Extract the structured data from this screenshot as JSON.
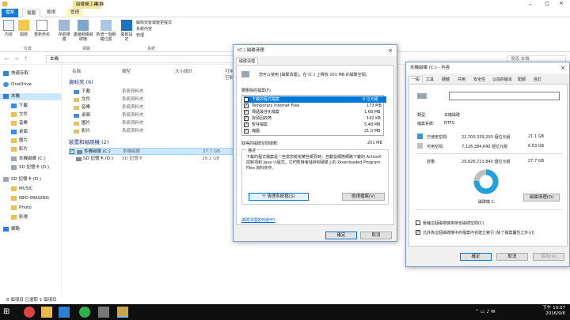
{
  "explorer": {
    "title": "本機",
    "context_tab": "磁碟機工具",
    "tabs": [
      "檔案",
      "電腦",
      "檢視",
      "管理"
    ],
    "ribbon": {
      "buttons": [
        "內容",
        "開啟",
        "重新命名",
        "存取媒體",
        "連線網路磁碟機",
        "新增一個網路位置",
        "開啟設定",
        "解除安裝或變更程式",
        "系統內容",
        "管理"
      ],
      "groups": [
        "位置",
        "網路",
        "系統"
      ]
    },
    "address": "本機",
    "search_placeholder": "搜尋 本機",
    "nav": [
      "快速存取",
      "OneDrive",
      "本機",
      "下載",
      "文件",
      "音樂",
      "桌面",
      "圖片",
      "影片",
      "本機磁碟 (C:)",
      "SD 記憶卡 (D:)",
      "SD 記憶卡 (D:)",
      "MUSIC",
      "NEO IMAGING",
      "Photo",
      "影視",
      "網路"
    ],
    "columns": [
      "名稱",
      "類型",
      "大小總計",
      "可用空間"
    ],
    "folders_header": "資料夾 (6)",
    "folders": [
      {
        "name": "下載",
        "type": "系統資料夾"
      },
      {
        "name": "文件",
        "type": "系統資料夾"
      },
      {
        "name": "音樂",
        "type": "系統資料夾"
      },
      {
        "name": "桌面",
        "type": "系統資料夾"
      },
      {
        "name": "圖片",
        "type": "系統資料夾"
      },
      {
        "name": "影片",
        "type": "系統資料夾"
      }
    ],
    "drives_header": "裝置和磁碟機 (2)",
    "drives": [
      {
        "name": "本機磁碟 (C:)",
        "type": "本機磁碟",
        "total": "27.7 GB",
        "free": "6.63 GB"
      },
      {
        "name": "SD 記憶卡 (D:)",
        "type": "SD 記憶卡",
        "total": "29.2 GB",
        "free": "29.1 GB"
      }
    ],
    "status": "8 個項目   已選取 1 個項目"
  },
  "cleanup": {
    "title": "(C:) 磁碟清理",
    "tab": "磁碟清理",
    "intro": "您可以使用 [磁碟清理]，在 (C:) 上釋放 201 MB 的磁碟空間。",
    "list_label": "要刪除的檔案(F):",
    "items": [
      {
        "name": "下載的程式檔案",
        "size": "0 位元組",
        "checked": true
      },
      {
        "name": "Temporary Internet Files",
        "size": "173 MB",
        "checked": true
      },
      {
        "name": "傳遞最佳化檔案",
        "size": "1.68 MB",
        "checked": true
      },
      {
        "name": "資源回收筒",
        "size": "142 KB",
        "checked": true
      },
      {
        "name": "暫存檔案",
        "size": "5.48 MB",
        "checked": true
      },
      {
        "name": "縮圖",
        "size": "21.0 MB",
        "checked": true
      }
    ],
    "total_label": "取得的磁碟空間總數:",
    "total_value": "201 MB",
    "desc_title": "描述",
    "desc": "下載的程式檔案是一些當您檢視某些網頁時，自動從網際網路下載的 ActiveX 控制項和 Java 小程式。它們暫時會儲存到硬碟上的 Downloaded Program Files 資料夾中。",
    "btn_clean_system": "清理系統檔(S)",
    "btn_view": "檢視檔案(V)",
    "link": "磁碟清理如何運作?",
    "ok": "確定",
    "cancel": "取消"
  },
  "props": {
    "title": "本機磁碟 (C:) - 內容",
    "tabs": [
      "一般",
      "工具",
      "硬體",
      "共用",
      "安全性",
      "以前的版本",
      "配額",
      "自訂"
    ],
    "type_label": "類型:",
    "type_value": "本機磁碟",
    "fs_label": "檔案系統:",
    "fs_value": "NTFS",
    "used_label": "已使用空間:",
    "used_bytes": "22,700,339,200 個位元組",
    "used_gb": "21.1 GB",
    "free_label": "可用空間:",
    "free_bytes": "7,126,384,640 個位元組",
    "free_gb": "6.63 GB",
    "cap_label": "容量:",
    "cap_bytes": "29,826,723,840 個位元組",
    "cap_gb": "27.7 GB",
    "used_fraction": 0.761,
    "drive_label": "磁碟機 C:",
    "btn_cleanup": "磁碟清理(D)",
    "cb1": "壓縮這個磁碟機來節省磁碟空間(C)",
    "cb2": "允許為這個磁碟機中的檔案內容建立索引 (除了檔案屬性之外)(I)",
    "ok": "確定",
    "cancel": "取消",
    "apply": "套用(A)",
    "used_color": "#26a0da",
    "free_color": "#bfbfbf"
  },
  "taskbar": {
    "time": "下午 10:07",
    "date": "2016/9/6"
  }
}
